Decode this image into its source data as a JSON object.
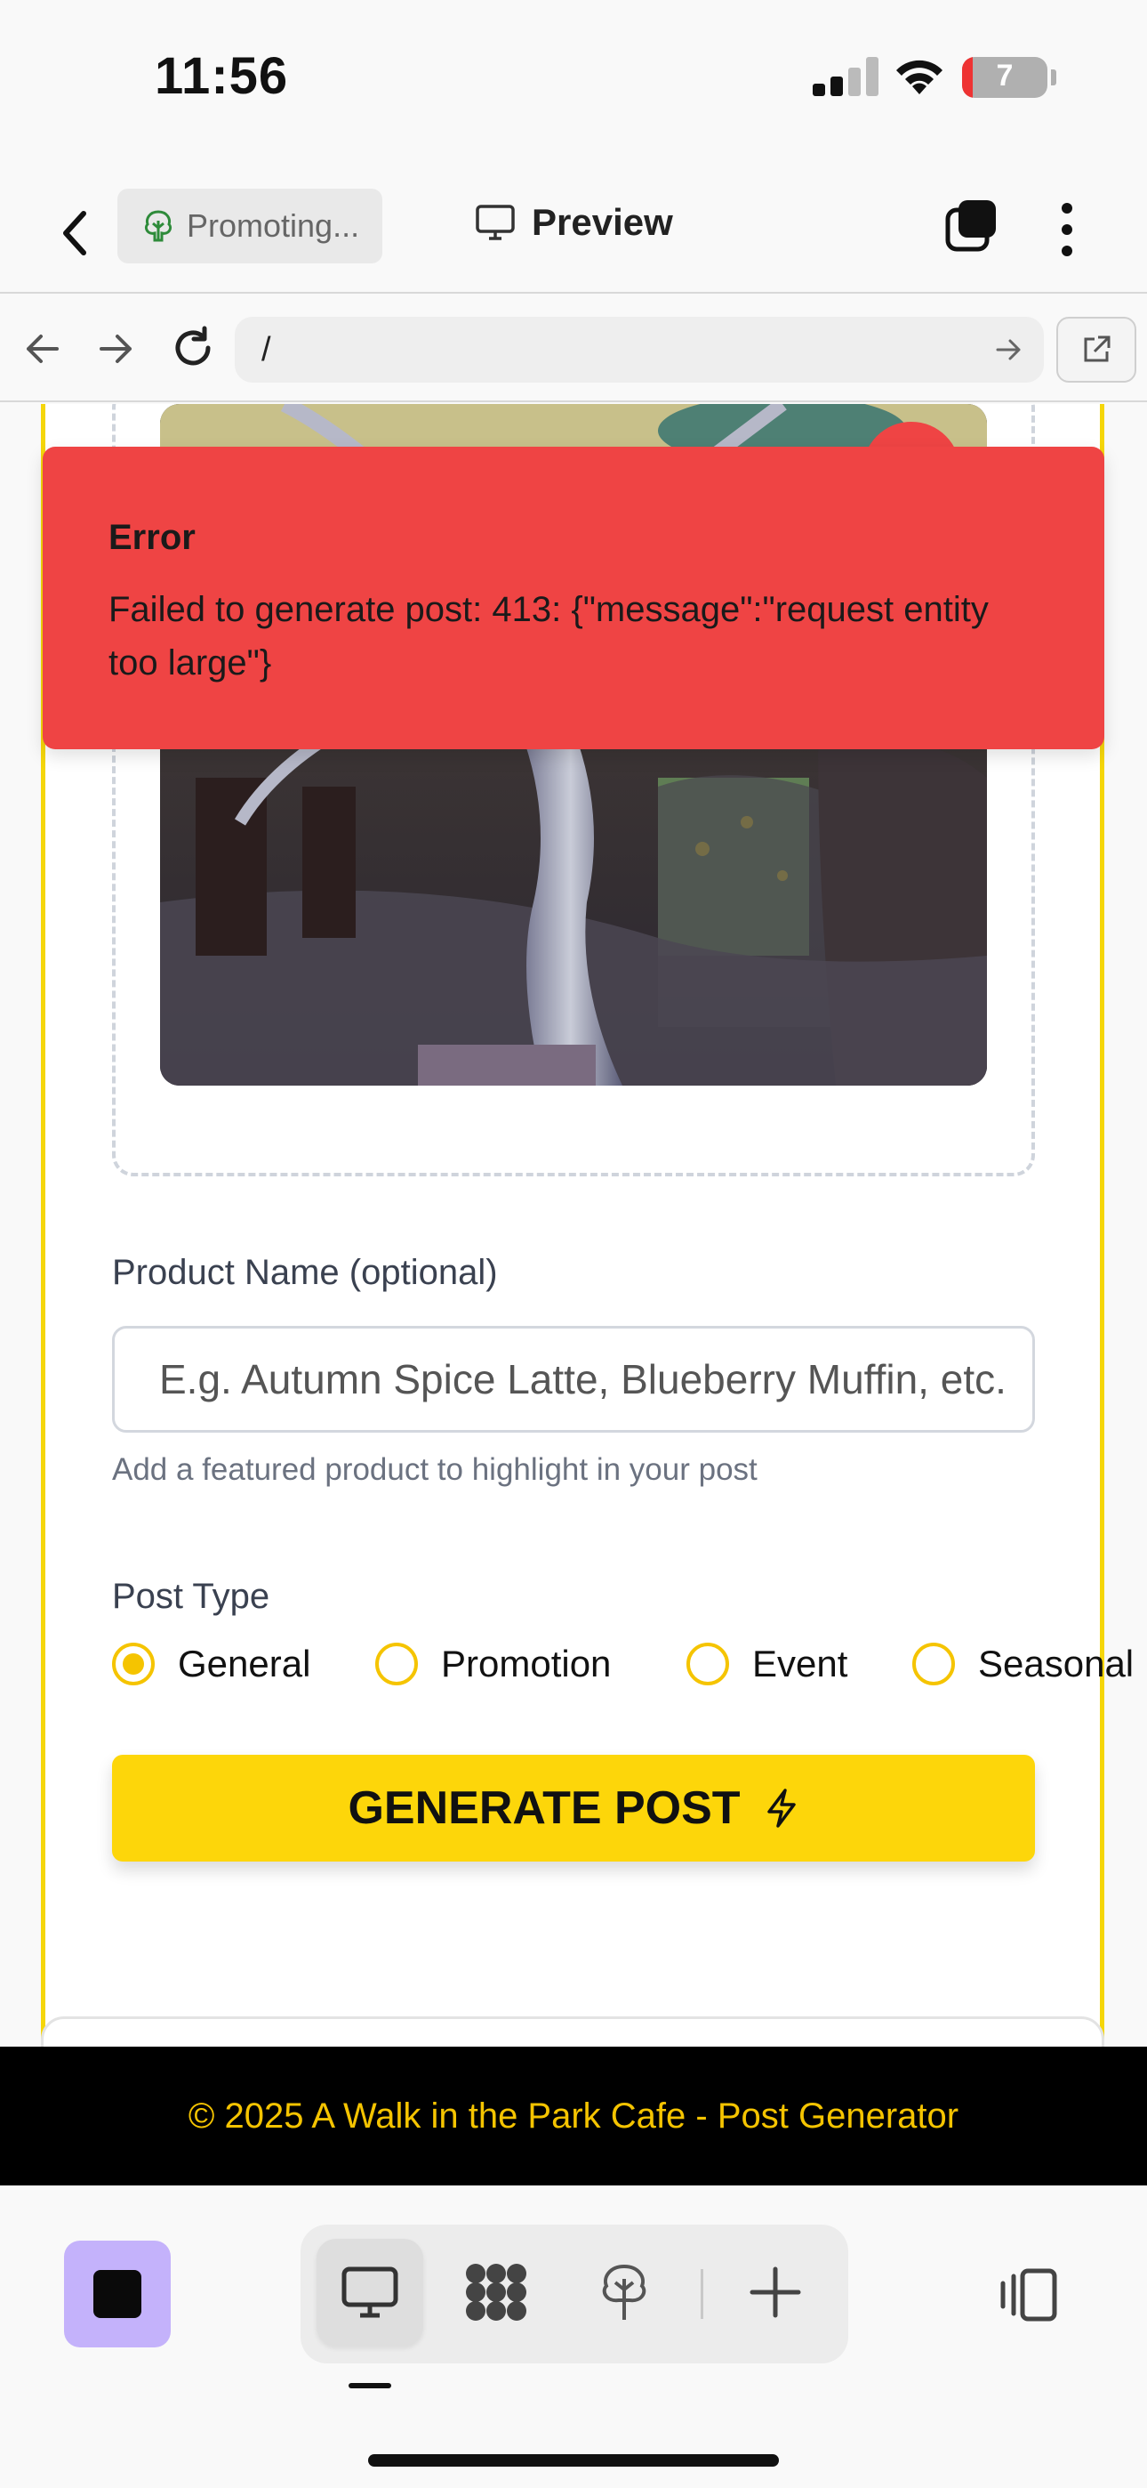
{
  "status_bar": {
    "time": "11:56",
    "battery": "7"
  },
  "app_bar": {
    "tab_chip_label": "Promoting...",
    "preview_label": "Preview"
  },
  "nav_bar": {
    "url": "/"
  },
  "toast": {
    "title": "Error",
    "message": "Failed to generate post: 413: {\"message\":\"request entity too large\"}"
  },
  "form": {
    "product_label": "Product Name (optional)",
    "product_placeholder": "E.g. Autumn Spice Latte, Blueberry Muffin, etc.",
    "product_helper": "Add a featured product to highlight in your post",
    "post_type_label": "Post Type",
    "post_types": [
      {
        "label": "General",
        "checked": true
      },
      {
        "label": "Promotion",
        "checked": false
      },
      {
        "label": "Event",
        "checked": false
      },
      {
        "label": "Seasonal",
        "checked": false
      }
    ],
    "generate_label": "GENERATE POST"
  },
  "footer": {
    "text": "© 2025 A Walk in the Park Cafe - Post Generator"
  },
  "colors": {
    "accent_yellow": "#fdd60a",
    "error_red": "#ef4444",
    "stop_purple": "#c4b2fb",
    "footer_text": "#f5c400"
  },
  "icons": {
    "back": "chevron-left-icon",
    "tree": "tree-icon",
    "monitor": "monitor-icon",
    "tabs": "tabs-icon",
    "more": "more-vertical-icon",
    "bolt": "lightning-icon"
  }
}
